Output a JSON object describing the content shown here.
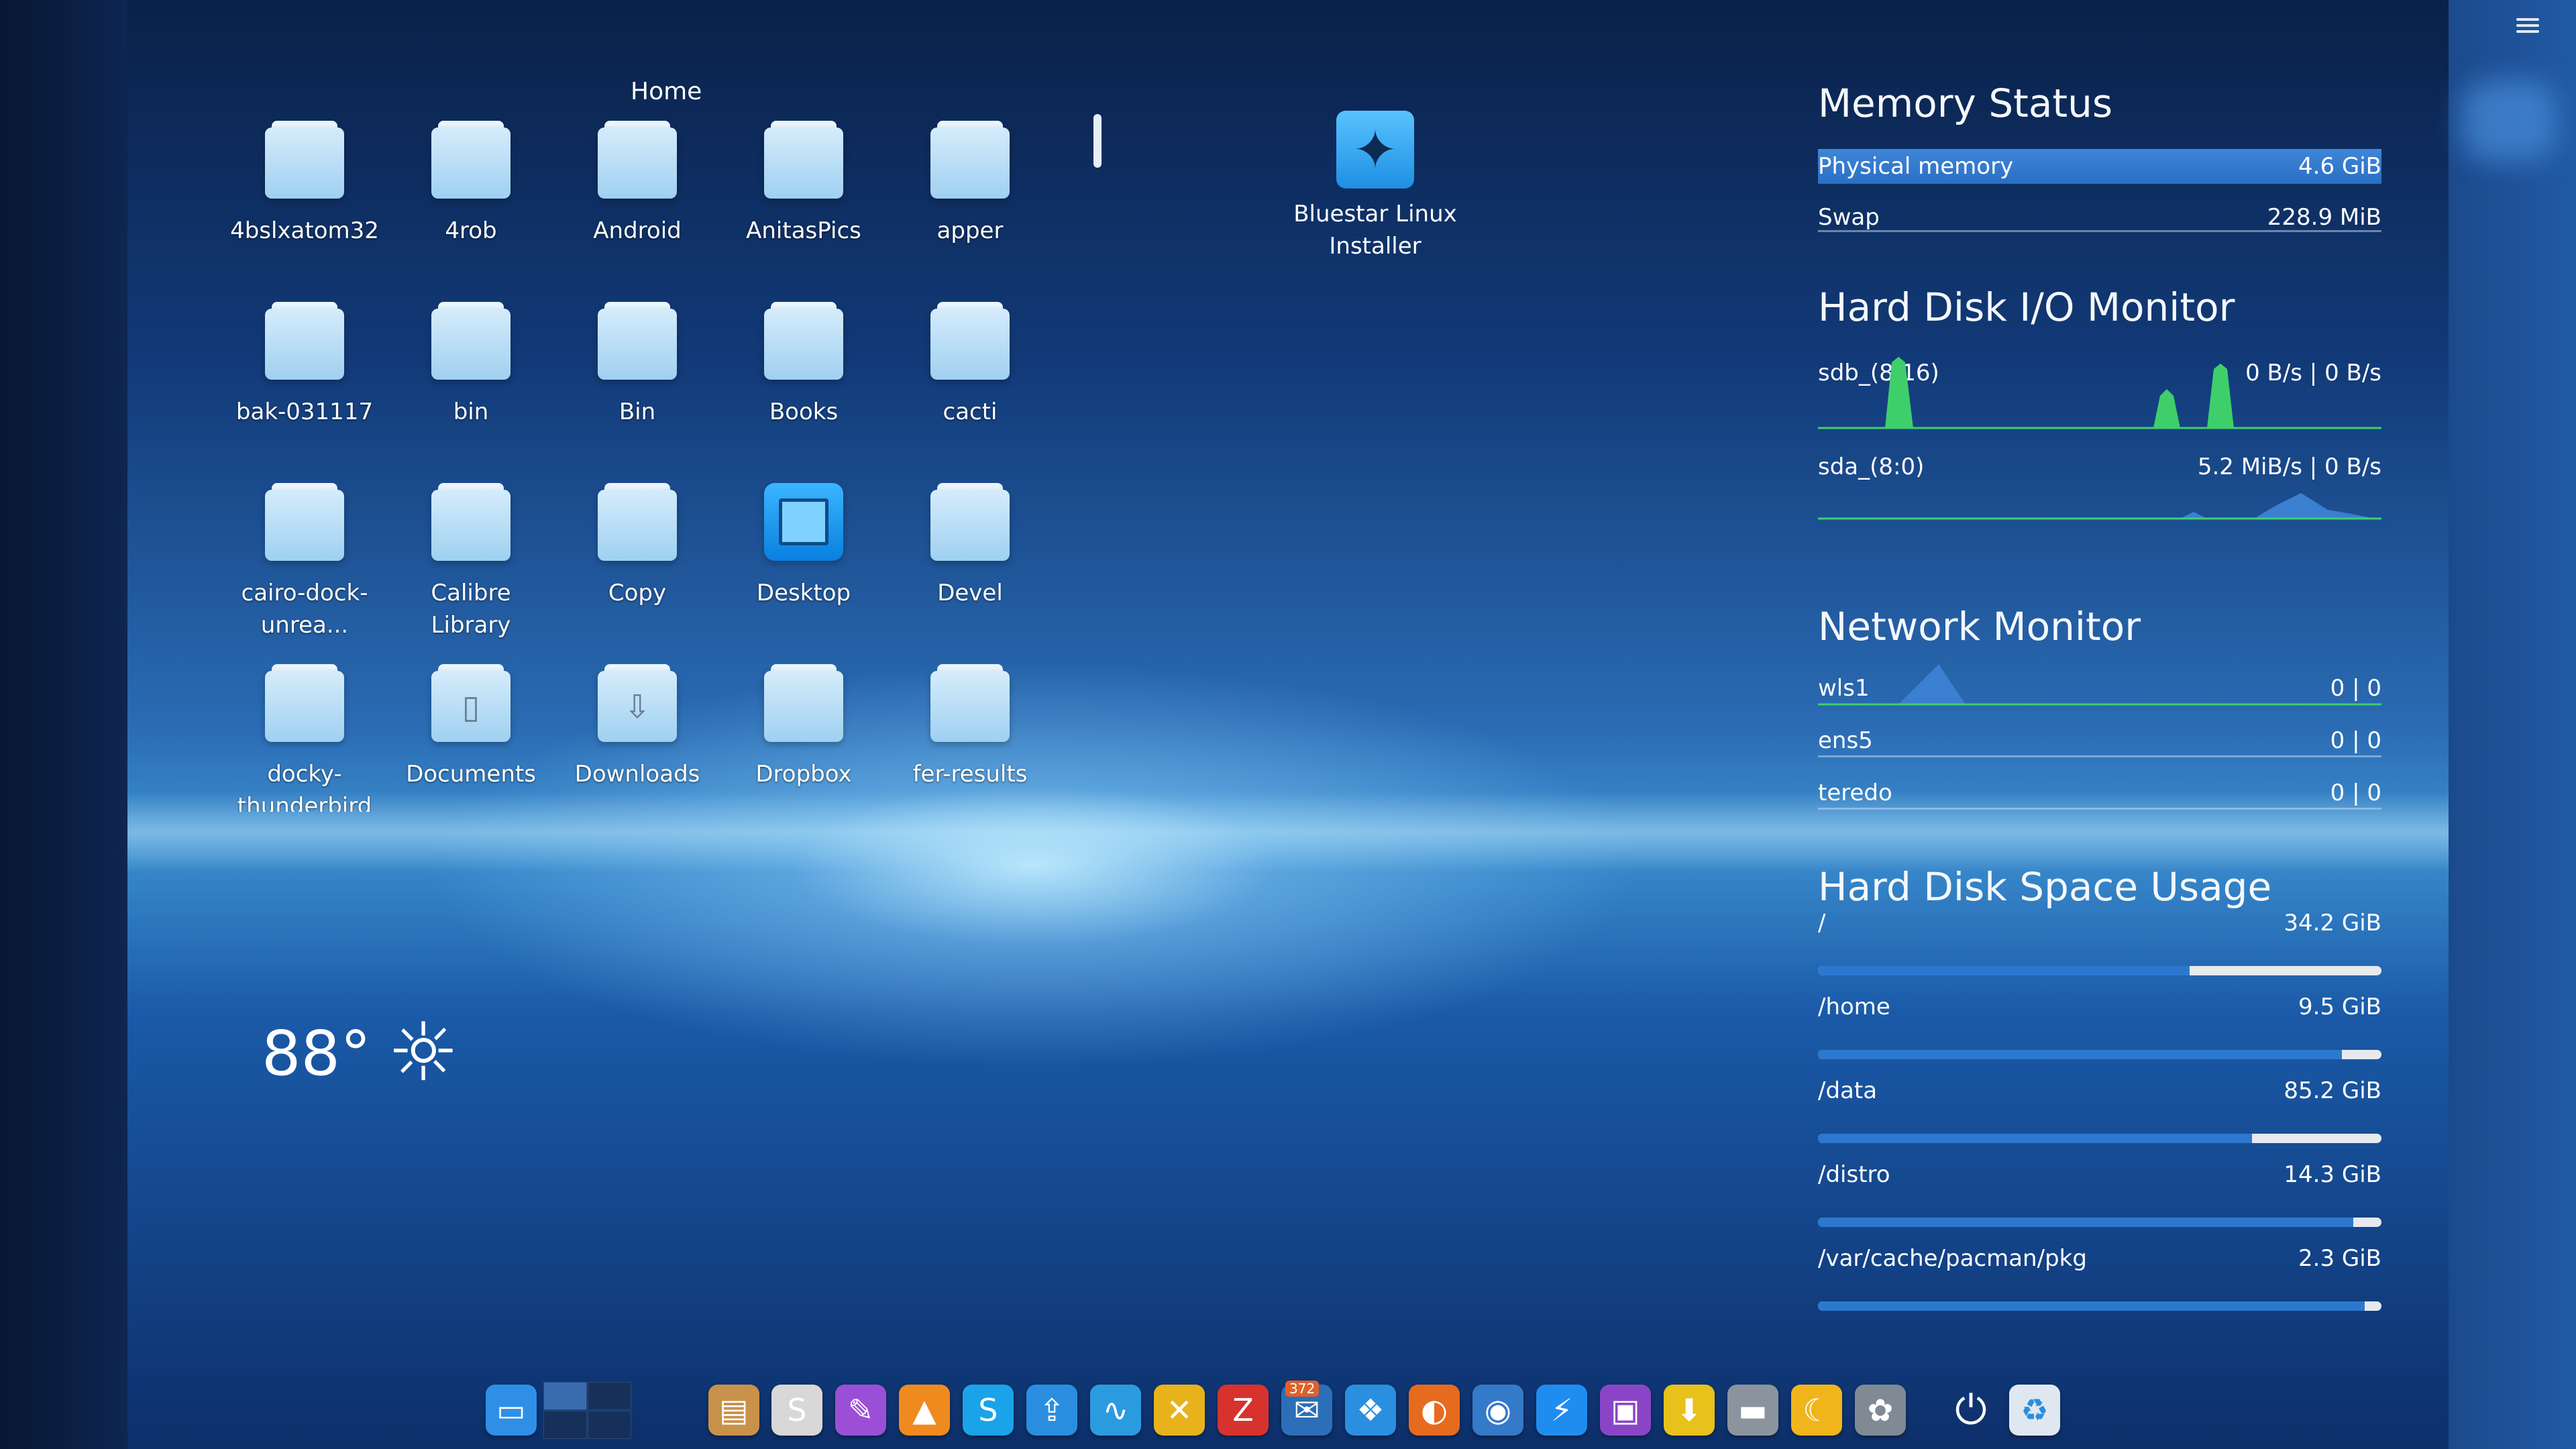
{
  "folder_view": {
    "title": "Home",
    "items": [
      {
        "label": "4bslxatom32",
        "icon": "folder-icon"
      },
      {
        "label": "4rob",
        "icon": "folder-icon"
      },
      {
        "label": "Android",
        "icon": "folder-icon"
      },
      {
        "label": "AnitasPics",
        "icon": "folder-icon"
      },
      {
        "label": "apper",
        "icon": "folder-icon"
      },
      {
        "label": "bak-031117",
        "icon": "folder-icon"
      },
      {
        "label": "bin",
        "icon": "folder-icon"
      },
      {
        "label": "Bin",
        "icon": "folder-icon"
      },
      {
        "label": "Books",
        "icon": "folder-icon"
      },
      {
        "label": "cacti",
        "icon": "folder-icon"
      },
      {
        "label": "cairo-dock-unrea...",
        "icon": "folder-icon"
      },
      {
        "label": "Calibre Library",
        "icon": "folder-icon"
      },
      {
        "label": "Copy",
        "icon": "folder-icon"
      },
      {
        "label": "Desktop",
        "icon": "desktop-folder-icon"
      },
      {
        "label": "Devel",
        "icon": "folder-icon"
      },
      {
        "label": "docky-thunderbird",
        "icon": "folder-icon"
      },
      {
        "label": "Documents",
        "icon": "documents-folder-icon"
      },
      {
        "label": "Downloads",
        "icon": "downloads-folder-icon"
      },
      {
        "label": "Dropbox",
        "icon": "folder-icon"
      },
      {
        "label": "fer-results",
        "icon": "folder-icon"
      }
    ]
  },
  "desktop_icon": {
    "label": "Bluestar Linux Installer",
    "icon": "compass-star-icon"
  },
  "weather": {
    "temperature": "88°",
    "condition_icon": "sun-icon"
  },
  "memory": {
    "title": "Memory Status",
    "physical_label": "Physical memory",
    "physical_value": "4.6 GiB",
    "swap_label": "Swap",
    "swap_value": "228.9 MiB"
  },
  "disk_io": {
    "title": "Hard Disk I/O Monitor",
    "devices": [
      {
        "name": "sdb_(8:16)",
        "value": "0 B/s | 0 B/s"
      },
      {
        "name": "sda_(8:0)",
        "value": "5.2 MiB/s | 0 B/s"
      }
    ]
  },
  "network": {
    "title": "Network Monitor",
    "interfaces": [
      {
        "name": "wls1",
        "value": "0 | 0"
      },
      {
        "name": "ens5",
        "value": "0 | 0"
      },
      {
        "name": "teredo",
        "value": "0 | 0"
      }
    ]
  },
  "disk_space": {
    "title": "Hard Disk Space Usage",
    "mounts": [
      {
        "path": "/",
        "value": "34.2 GiB",
        "used_fraction": 0.66
      },
      {
        "path": "/home",
        "value": "9.5 GiB",
        "used_fraction": 0.93
      },
      {
        "path": "/data",
        "value": "85.2 GiB",
        "used_fraction": 0.77
      },
      {
        "path": "/distro",
        "value": "14.3 GiB",
        "used_fraction": 0.95
      },
      {
        "path": "/var/cache/pacman/pkg",
        "value": "2.3 GiB",
        "used_fraction": 0.97
      }
    ]
  },
  "dock": {
    "badge": "372",
    "apps": [
      {
        "name": "desktop-icon",
        "color": "#2f8fe6",
        "glyph": "▭"
      },
      {
        "name": "files-icon",
        "color": "#c9924a",
        "glyph": "▤"
      },
      {
        "name": "text-editor-icon",
        "color": "#d8d8d8",
        "glyph": "S"
      },
      {
        "name": "pen-tool-icon",
        "color": "#9b4fd6",
        "glyph": "✎"
      },
      {
        "name": "vlc-icon",
        "color": "#ef8a1e",
        "glyph": "▲"
      },
      {
        "name": "skype-icon",
        "color": "#1aa3e8",
        "glyph": "S"
      },
      {
        "name": "share-icon",
        "color": "#2a8ee0",
        "glyph": "⇪"
      },
      {
        "name": "system-monitor-icon",
        "color": "#2b9be0",
        "glyph": "∿"
      },
      {
        "name": "tools-icon",
        "color": "#e8b21c",
        "glyph": "✕"
      },
      {
        "name": "filezilla-icon",
        "color": "#d8322f",
        "glyph": "Z"
      },
      {
        "name": "mail-icon",
        "color": "#2c6fb8",
        "glyph": "✉"
      },
      {
        "name": "dropbox-icon",
        "color": "#2b8fe0",
        "glyph": "❖"
      },
      {
        "name": "firefox-icon",
        "color": "#e66b1e",
        "glyph": "◐"
      },
      {
        "name": "chromium-icon",
        "color": "#3579c9",
        "glyph": "◉"
      },
      {
        "name": "messenger-icon",
        "color": "#1f8df0",
        "glyph": "⚡"
      },
      {
        "name": "chat-icon",
        "color": "#8a45c6",
        "glyph": "▣"
      },
      {
        "name": "download-icon",
        "color": "#e8c21a",
        "glyph": "⬇"
      },
      {
        "name": "toggle-icon",
        "color": "#8b949e",
        "glyph": "▬"
      },
      {
        "name": "night-mode-icon",
        "color": "#f0b51a",
        "glyph": "☾"
      },
      {
        "name": "gimp-icon",
        "color": "#7f8a94",
        "glyph": "✿"
      },
      {
        "name": "power-icon",
        "color": "#00000000",
        "glyph": "⏻"
      },
      {
        "name": "recycle-icon",
        "color": "#dfe8f0",
        "glyph": "♻"
      }
    ]
  }
}
